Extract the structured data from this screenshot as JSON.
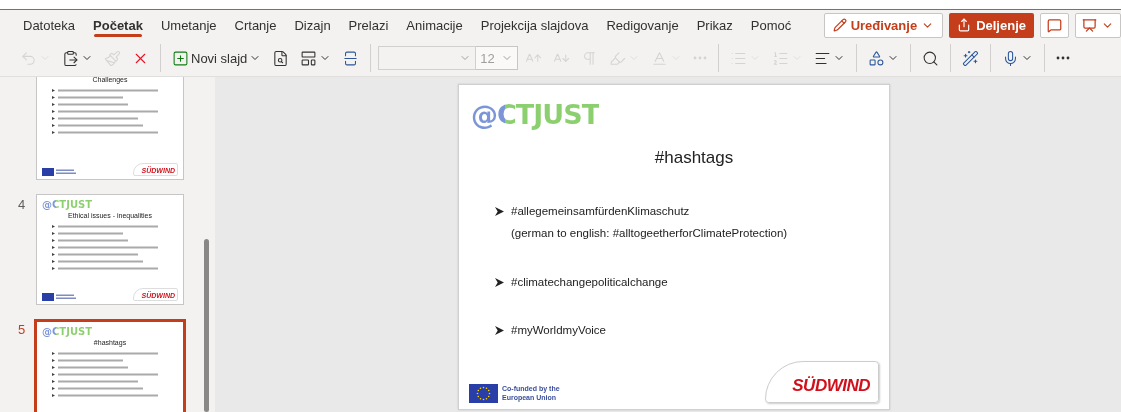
{
  "tabs": [
    {
      "label": "Datoteka",
      "selected": false
    },
    {
      "label": "Početak",
      "selected": true
    },
    {
      "label": "Umetanje",
      "selected": false
    },
    {
      "label": "Crtanje",
      "selected": false
    },
    {
      "label": "Dizajn",
      "selected": false
    },
    {
      "label": "Prelazi",
      "selected": false
    },
    {
      "label": "Animacije",
      "selected": false
    },
    {
      "label": "Projekcija slajdova",
      "selected": false
    },
    {
      "label": "Redigovanje",
      "selected": false
    },
    {
      "label": "Prikaz",
      "selected": false
    },
    {
      "label": "Pomoć",
      "selected": false
    }
  ],
  "mode_button": {
    "label": "Uređivanje"
  },
  "share_button": {
    "label": "Deljenje"
  },
  "toolbar": [
    {
      "kind": "undo",
      "caret": true,
      "disabled": true
    },
    {
      "kind": "paste",
      "caret": true,
      "disabled": false
    },
    {
      "kind": "brush",
      "caret": false,
      "disabled": true
    },
    {
      "kind": "delete",
      "caret": false,
      "disabled": false
    },
    {
      "kind": "sep"
    },
    {
      "kind": "newslide",
      "label": "Novi slajd",
      "caret": true,
      "disabled": false
    },
    {
      "kind": "reuse",
      "caret": false,
      "disabled": false
    },
    {
      "kind": "layout",
      "caret": true,
      "disabled": false
    },
    {
      "kind": "background",
      "caret": false,
      "disabled": false
    },
    {
      "kind": "sep"
    },
    {
      "kind": "font",
      "disabled": true
    },
    {
      "kind": "size",
      "value": "12",
      "disabled": true
    },
    {
      "kind": "grow",
      "caret": false,
      "disabled": true
    },
    {
      "kind": "shrink",
      "caret": false,
      "disabled": true
    },
    {
      "kind": "para",
      "caret": false,
      "disabled": true
    },
    {
      "kind": "highlight",
      "caret": true,
      "disabled": true
    },
    {
      "kind": "fontcolor",
      "caret": true,
      "disabled": true
    },
    {
      "kind": "more",
      "caret": false,
      "disabled": true
    },
    {
      "kind": "sep"
    },
    {
      "kind": "bullets",
      "caret": true,
      "disabled": true
    },
    {
      "kind": "numbering",
      "caret": true,
      "disabled": true
    },
    {
      "kind": "align",
      "caret": true,
      "disabled": false
    },
    {
      "kind": "sep"
    },
    {
      "kind": "shapes",
      "caret": true,
      "disabled": false
    },
    {
      "kind": "sep"
    },
    {
      "kind": "find",
      "caret": false,
      "disabled": false
    },
    {
      "kind": "sep"
    },
    {
      "kind": "designer",
      "caret": false,
      "disabled": false
    },
    {
      "kind": "sep"
    },
    {
      "kind": "dictate",
      "caret": true,
      "disabled": false
    },
    {
      "kind": "sep"
    },
    {
      "kind": "more",
      "caret": false,
      "disabled": false
    }
  ],
  "thumbnails": [
    {
      "selected": false,
      "title": "Challenges",
      "brand": "SÜDWIND"
    },
    {
      "number": "4",
      "selected": false,
      "logo": "@CTJUST",
      "title": "Ethical issues - inequalities",
      "brand": "SÜDWIND"
    },
    {
      "number": "5",
      "selected": true,
      "logo": "@CTJUST",
      "title": "#hashtags"
    }
  ],
  "slide": {
    "logo": "@CTJUST",
    "title": "#hashtags",
    "bullets": [
      {
        "lines": [
          "#allegemeinsamfürdenKlimaschutz",
          "(german to english: #alltogeetherforClimateProtection)"
        ]
      },
      {
        "lines": [
          "#climatechangepoliticalchange"
        ]
      },
      {
        "lines": [
          "#myWorldmyVoice"
        ]
      }
    ],
    "funding": "Co-funded by the European Union",
    "brand": "SÜDWIND"
  }
}
